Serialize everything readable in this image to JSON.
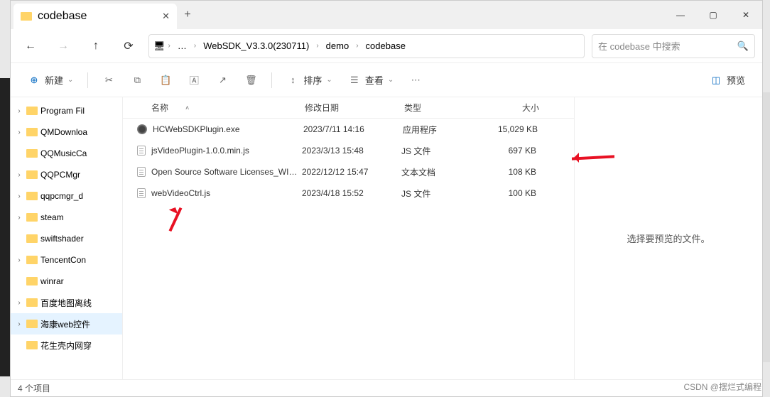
{
  "tab": {
    "title": "codebase"
  },
  "breadcrumbs": {
    "ellipsis": "…",
    "p1": "WebSDK_V3.3.0(230711)",
    "p2": "demo",
    "p3": "codebase"
  },
  "search": {
    "placeholder": "在 codebase 中搜索"
  },
  "toolbar": {
    "new": "新建",
    "sort": "排序",
    "view": "查看",
    "preview": "预览"
  },
  "columns": {
    "name": "名称",
    "date": "修改日期",
    "type": "类型",
    "size": "大小"
  },
  "tree": {
    "n0": "Program Fil",
    "n1": "QMDownloa",
    "n2": "QQMusicCa",
    "n3": "QQPCMgr",
    "n4": "qqpcmgr_d",
    "n5": "steam",
    "n6": "swiftshader",
    "n7": "TencentCon",
    "n8": "winrar",
    "n9": "百度地图离线",
    "n10": "海康web控件",
    "n11": "花生壳内网穿"
  },
  "files": {
    "r0": {
      "name": "HCWebSDKPlugin.exe",
      "date": "2023/7/11 14:16",
      "type": "应用程序",
      "size": "15,029 KB"
    },
    "r1": {
      "name": "jsVideoPlugin-1.0.0.min.js",
      "date": "2023/3/13 15:48",
      "type": "JS 文件",
      "size": "697 KB"
    },
    "r2": {
      "name": "Open Source Software Licenses_WIN...",
      "date": "2022/12/12 15:47",
      "type": "文本文档",
      "size": "108 KB"
    },
    "r3": {
      "name": "webVideoCtrl.js",
      "date": "2023/4/18 15:52",
      "type": "JS 文件",
      "size": "100 KB"
    }
  },
  "preview_hint": "选择要预览的文件。",
  "status": "4 个项目",
  "watermark": "CSDN @摆烂式编程"
}
